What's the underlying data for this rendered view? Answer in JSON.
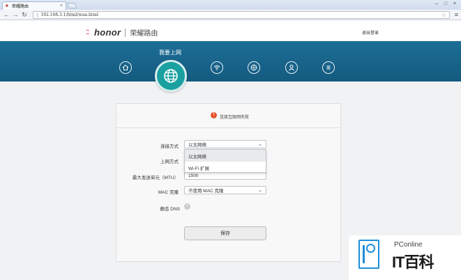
{
  "browser": {
    "tab_title": "荣耀路由",
    "url": "192.168.3.1/html/wan.html",
    "back_icon": "back-arrow-icon",
    "forward_icon": "forward-arrow-icon",
    "reload_icon": "reload-icon"
  },
  "header": {
    "brand": "honor",
    "product": "荣耀路由",
    "logout": "退出登录"
  },
  "banner": {
    "title": "我要上网",
    "nav_items": [
      "home-icon",
      "internet-globe-icon",
      "wifi-icon",
      "network-icon",
      "user-icon",
      "more-menu-icon"
    ],
    "active_item": "internet-globe-icon"
  },
  "status": {
    "icon_glyph": "!",
    "text": "连接互联网失败"
  },
  "form": {
    "connection_type_label": "连接方式",
    "connection_type_value": "以太网络",
    "internet_mode_label": "上网方式",
    "mtu_label": "最大发送单元（MTU）",
    "mtu_value": "1500",
    "mac_clone_label": "MAC 克隆",
    "mac_clone_value": "不使用 MAC 克隆",
    "static_dns_label": "静态 DNS",
    "dropdown_options": [
      "以太网络",
      "Wi-Fi 扩展"
    ],
    "dropdown_selected": 0,
    "save_label": "保存"
  },
  "watermark": {
    "brand": "PConline",
    "name": "IT百科"
  },
  "colors": {
    "banner": "#1d6e97",
    "active_nav": "#1aa0a0",
    "error": "#e6542a",
    "watermark": "#1c8ed9"
  }
}
